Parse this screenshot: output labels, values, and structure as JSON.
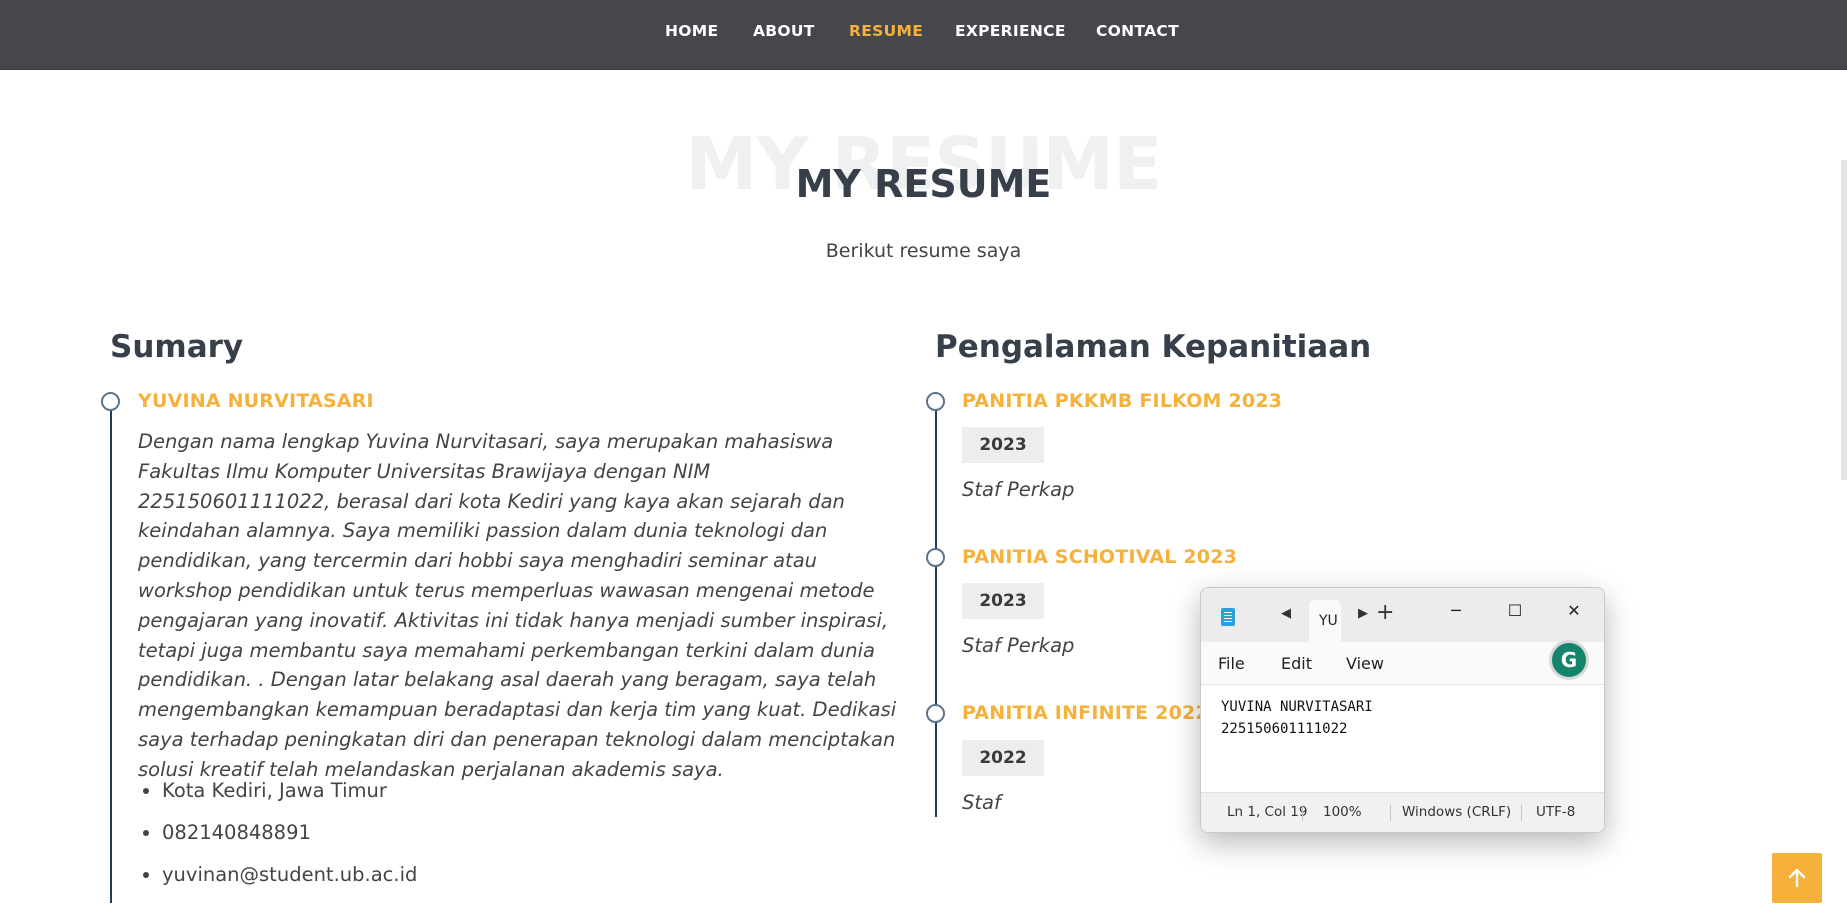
{
  "nav": {
    "items": [
      "HOME",
      "ABOUT",
      "RESUME",
      "EXPERIENCE",
      "CONTACT"
    ],
    "active": "RESUME",
    "active_color": "#f5b13a"
  },
  "section": {
    "bg_title": "MY RESUME",
    "title": "MY RESUME",
    "subtitle": "Berikut resume saya"
  },
  "summary": {
    "heading": "Sumary",
    "name": "YUVINA NURVITASARI",
    "paragraph": "Dengan nama lengkap Yuvina Nurvitasari, saya merupakan mahasiswa Fakultas Ilmu Komputer Universitas Brawijaya dengan NIM 225150601111022, berasal dari kota Kediri yang kaya akan sejarah dan keindahan alamnya. Saya memiliki passion dalam dunia teknologi dan pendidikan, yang tercermin dari hobbi saya menghadiri seminar atau workshop pendidikan untuk terus memperluas wawasan mengenai metode pengajaran yang inovatif. Aktivitas ini tidak hanya menjadi sumber inspirasi, tetapi juga membantu saya memahami perkembangan terkini dalam dunia pendidikan. . Dengan latar belakang asal daerah yang beragam, saya telah mengembangkan kemampuan beradaptasi dan kerja tim yang kuat. Dedikasi saya terhadap peningkatan diri dan penerapan teknologi dalam menciptakan solusi kreatif telah melandaskan perjalanan akademis saya.",
    "contacts": [
      "Kota Kediri, Jawa Timur",
      "082140848891",
      "yuvinan@student.ub.ac.id"
    ]
  },
  "experience": {
    "heading": "Pengalaman Kepanitiaan",
    "items": [
      {
        "title": "PANITIA PKKMB FILKOM 2023",
        "year": "2023",
        "role": "Staf Perkap"
      },
      {
        "title": "PANITIA SCHOTIVAL 2023",
        "year": "2023",
        "role": "Staf Perkap"
      },
      {
        "title": "PANITIA INFINITE 2022",
        "year": "2022",
        "role": "Staf"
      }
    ]
  },
  "notepad": {
    "tab_label": "YU",
    "menu": [
      "File",
      "Edit",
      "View"
    ],
    "lines": [
      "YUVINA NURVITASARI",
      "225150601111022"
    ],
    "status": {
      "position": "Ln 1, Col 19",
      "zoom": "100%",
      "line_ending": "Windows (CRLF)",
      "encoding": "UTF-8"
    },
    "grammarly_letter": "G",
    "icons": [
      "notepad-app-icon",
      "back-arrow-icon",
      "forward-arrow-icon",
      "new-tab-plus-icon",
      "minimize-icon",
      "maximize-icon",
      "close-icon",
      "grammarly-icon"
    ]
  },
  "back_to_top": {
    "icon": "arrow-up-icon",
    "color": "#f5b13a"
  }
}
